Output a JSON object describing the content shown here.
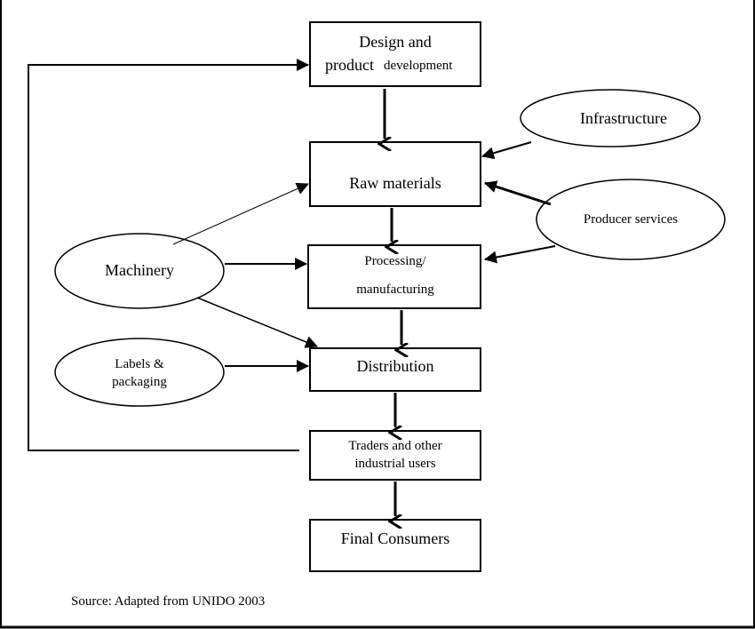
{
  "nodes": {
    "design": {
      "line1": "Design and",
      "line2a": "product",
      "line2b": "development"
    },
    "raw": {
      "label": "Raw materials"
    },
    "processing": {
      "line1": "Processing/",
      "line2": "manufacturing"
    },
    "distribution": {
      "label": "Distribution"
    },
    "traders": {
      "line1": "Traders and other",
      "line2": "industrial users"
    },
    "final": {
      "label": "Final Consumers"
    },
    "infrastructure": {
      "label": "Infrastructure"
    },
    "producer": {
      "label": "Producer services"
    },
    "machinery": {
      "label": "Machinery"
    },
    "labels": {
      "line1": "Labels &",
      "line2": "packaging"
    }
  },
  "source": "Source: Adapted from UNIDO 2003"
}
